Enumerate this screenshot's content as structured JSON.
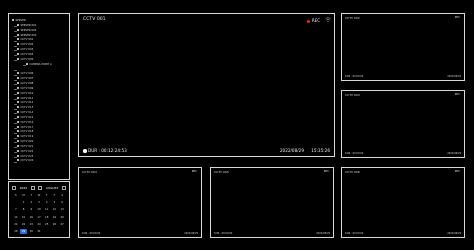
{
  "tree": {
    "items": [
      {
        "label": "SERVER",
        "level": 0
      },
      {
        "label": "SERVER 001",
        "level": 1
      },
      {
        "label": "SERVER 002",
        "level": 1
      },
      {
        "label": "SERVER 003",
        "level": 1
      },
      {
        "label": "CCTV 001",
        "level": 2
      },
      {
        "label": "CCTV 002",
        "level": 2
      },
      {
        "label": "CCTV 003",
        "level": 2
      },
      {
        "label": "CCTV 004",
        "level": 2
      },
      {
        "label": "CCTV 005",
        "level": 2
      },
      {
        "label": "CAMERA POINT A",
        "level": 3
      },
      {
        "label": "",
        "level": 2
      },
      {
        "label": "CCTV 006",
        "level": 2
      },
      {
        "label": "CCTV 007",
        "level": 2
      },
      {
        "label": "CCTV 008",
        "level": 2
      },
      {
        "label": "CCTV 009",
        "level": 2
      },
      {
        "label": "CCTV 010",
        "level": 2
      },
      {
        "label": "CCTV 011",
        "level": 2
      },
      {
        "label": "CCTV 012",
        "level": 2
      },
      {
        "label": "CCTV 013",
        "level": 2
      },
      {
        "label": "CCTV 014",
        "level": 2
      },
      {
        "label": "CCTV 015",
        "level": 2
      },
      {
        "label": "CCTV 016",
        "level": 2
      },
      {
        "label": "CCTV 017",
        "level": 2
      },
      {
        "label": "CCTV 018",
        "level": 2
      },
      {
        "label": "CCTV 019",
        "level": 2
      },
      {
        "label": "CCTV 020",
        "level": 2
      },
      {
        "label": "CCTV 021",
        "level": 2
      },
      {
        "label": "CCTV 022",
        "level": 2
      },
      {
        "label": "CCTV 023",
        "level": 2
      },
      {
        "label": "CCTV 024",
        "level": 2
      }
    ]
  },
  "calendar": {
    "year": "2022",
    "month": "AUGUST",
    "days": [
      "S",
      "M",
      "T",
      "W",
      "T",
      "F",
      "S"
    ],
    "dates": [
      "",
      "1",
      "2",
      "3",
      "4",
      "5",
      "6",
      "7",
      "8",
      "9",
      "10",
      "11",
      "12",
      "13",
      "14",
      "15",
      "16",
      "17",
      "18",
      "19",
      "20",
      "21",
      "22",
      "23",
      "24",
      "25",
      "26",
      "27",
      "28",
      "29",
      "30",
      "31",
      "",
      "",
      ""
    ],
    "selected": "29"
  },
  "main_camera": {
    "title": "CCTV 001",
    "rec_label": "REC",
    "duration": "DUR : 00:12:24:53",
    "date": "2022/08/29",
    "time": "15:35:26"
  },
  "side_cameras": [
    {
      "title": "CCTV 002",
      "rec": "REC",
      "foot_left": "DUR : 00:00:00",
      "foot_right": "2022/08/29"
    },
    {
      "title": "CCTV 003",
      "rec": "REC",
      "foot_left": "DUR : 00:00:00",
      "foot_right": "2022/08/29"
    },
    {
      "title": "CCTV 004",
      "rec": "REC",
      "foot_left": "DUR : 00:00:00",
      "foot_right": "2022/08/29"
    },
    {
      "title": "CCTV 005",
      "rec": "REC",
      "foot_left": "DUR : 00:00:00",
      "foot_right": "2022/08/29"
    },
    {
      "title": "CCTV 006",
      "rec": "REC",
      "foot_left": "DUR : 00:00:00",
      "foot_right": "2022/08/29"
    },
    {
      "title": "CCTV 007",
      "rec": "REC",
      "foot_left": "DUR : 00:00:00",
      "foot_right": "2022/08/29"
    }
  ],
  "colors": {
    "rec": "#e22222",
    "selected_date": "#2d6fd8",
    "border": "#d8d8d8"
  }
}
